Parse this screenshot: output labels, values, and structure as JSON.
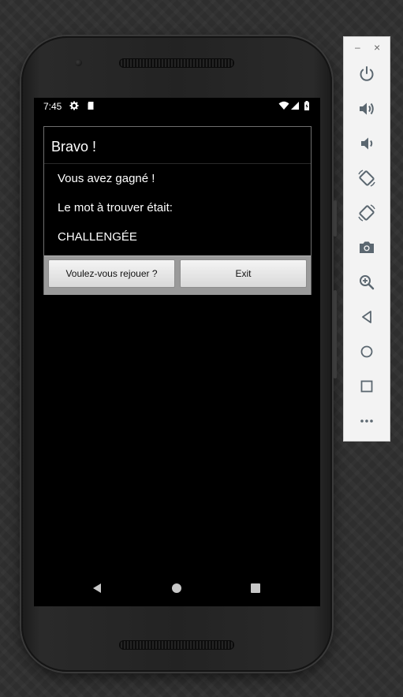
{
  "status_bar": {
    "time": "7:45"
  },
  "dialog": {
    "title": "Bravo !",
    "lines": [
      "Vous avez gagné !",
      "Le mot à trouver était:",
      "CHALLENGÉE"
    ],
    "buttons": {
      "replay_label": "Voulez-vous rejouer ?",
      "exit_label": "Exit"
    }
  },
  "emulator_toolbar": {
    "window_controls": {
      "minimize": "–",
      "close": "×"
    },
    "tools": [
      "power-icon",
      "volume-up-icon",
      "volume-down-icon",
      "rotate-left-icon",
      "rotate-right-icon",
      "camera-icon",
      "zoom-icon",
      "back-icon",
      "home-icon",
      "overview-icon",
      "more-icon"
    ]
  },
  "colors": {
    "dialog_button_bar": "#9a9a9a",
    "emulator_icon": "#5b6770"
  }
}
